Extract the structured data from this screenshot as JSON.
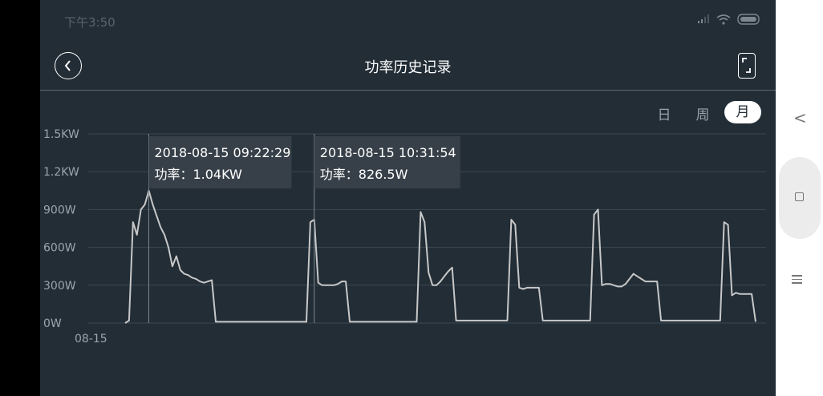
{
  "status": {
    "time": "下午3:50"
  },
  "header": {
    "title": "功率历史记录"
  },
  "range_tabs": {
    "day": "日",
    "week": "周",
    "month": "月",
    "active": "month"
  },
  "tooltips": [
    {
      "time": "2018-08-15 09:22:29",
      "value": "功率：1.04KW"
    },
    {
      "time": "2018-08-15 10:31:54",
      "value": "功率：826.5W"
    }
  ],
  "colors": {
    "background": "#222d36",
    "line": "#c8c8c8",
    "grid": "#3a4751",
    "text": "#9aa5ae"
  },
  "chart_data": {
    "type": "line",
    "title": "",
    "xlabel": "",
    "ylabel": "",
    "x_tick_labels": [
      "08-15"
    ],
    "y_tick_labels": [
      "0W",
      "300W",
      "600W",
      "900W",
      "1.2KW",
      "1.5KW"
    ],
    "y_tick_values": [
      0,
      300,
      600,
      900,
      1200,
      1500
    ],
    "ylim": [
      0,
      1500
    ],
    "grid": true,
    "series": [
      {
        "values": [
          0,
          20,
          800,
          700,
          900,
          940,
          1050,
          940,
          850,
          760,
          700,
          600,
          450,
          530,
          420,
          390,
          380,
          360,
          350,
          330,
          320,
          330,
          340,
          10,
          10,
          10,
          10,
          10,
          10,
          10,
          10,
          10,
          10,
          10,
          10,
          10,
          10,
          10,
          10,
          10,
          10,
          10,
          10,
          10,
          10,
          10,
          10,
          800,
          820,
          320,
          300,
          300,
          300,
          300,
          310,
          330,
          330,
          10,
          10,
          10,
          10,
          10,
          10,
          10,
          10,
          10,
          10,
          10,
          10,
          10,
          10,
          10,
          10,
          10,
          10,
          880,
          800,
          400,
          300,
          300,
          330,
          370,
          410,
          440,
          20,
          20,
          20,
          20,
          20,
          20,
          20,
          20,
          20,
          20,
          20,
          20,
          20,
          20,
          820,
          780,
          280,
          270,
          280,
          280,
          280,
          280,
          20,
          20,
          20,
          20,
          20,
          20,
          20,
          20,
          20,
          20,
          20,
          20,
          20,
          860,
          900,
          300,
          310,
          310,
          300,
          290,
          290,
          310,
          350,
          390,
          370,
          350,
          330,
          330,
          330,
          330,
          20,
          20,
          20,
          20,
          20,
          20,
          20,
          20,
          20,
          20,
          20,
          20,
          20,
          20,
          20,
          20,
          800,
          780,
          220,
          240,
          230,
          230,
          230,
          230,
          10
        ]
      }
    ]
  }
}
